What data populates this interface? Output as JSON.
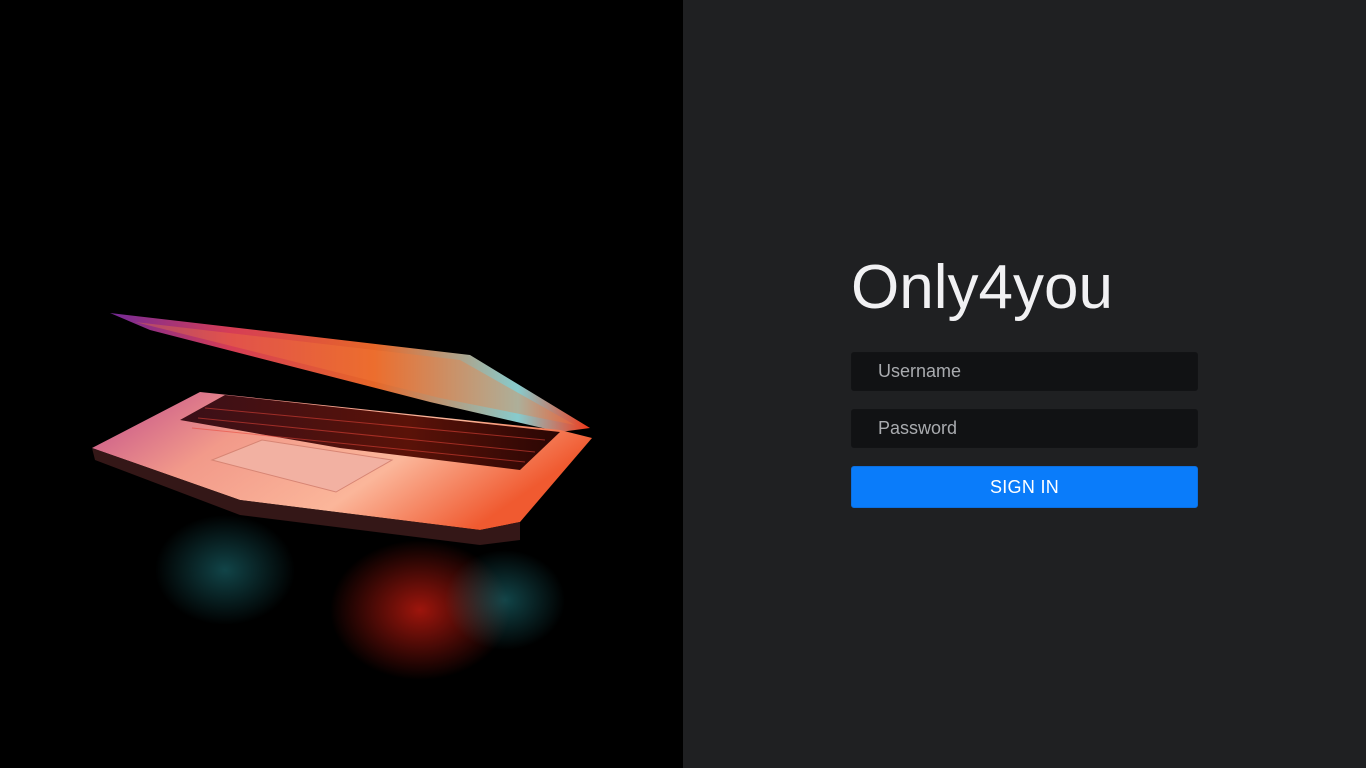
{
  "brand": {
    "title": "Only4you"
  },
  "login_form": {
    "username_placeholder": "Username",
    "username_value": "",
    "password_placeholder": "Password",
    "password_value": "",
    "submit_label": "SIGN IN"
  },
  "colors": {
    "panel_background": "#1f2022",
    "hero_background": "#000000",
    "input_background": "#111214",
    "button_primary": "#0a7cfa",
    "title_text": "#f1f1f3"
  },
  "hero_image": {
    "icon": "laptop-photo"
  }
}
